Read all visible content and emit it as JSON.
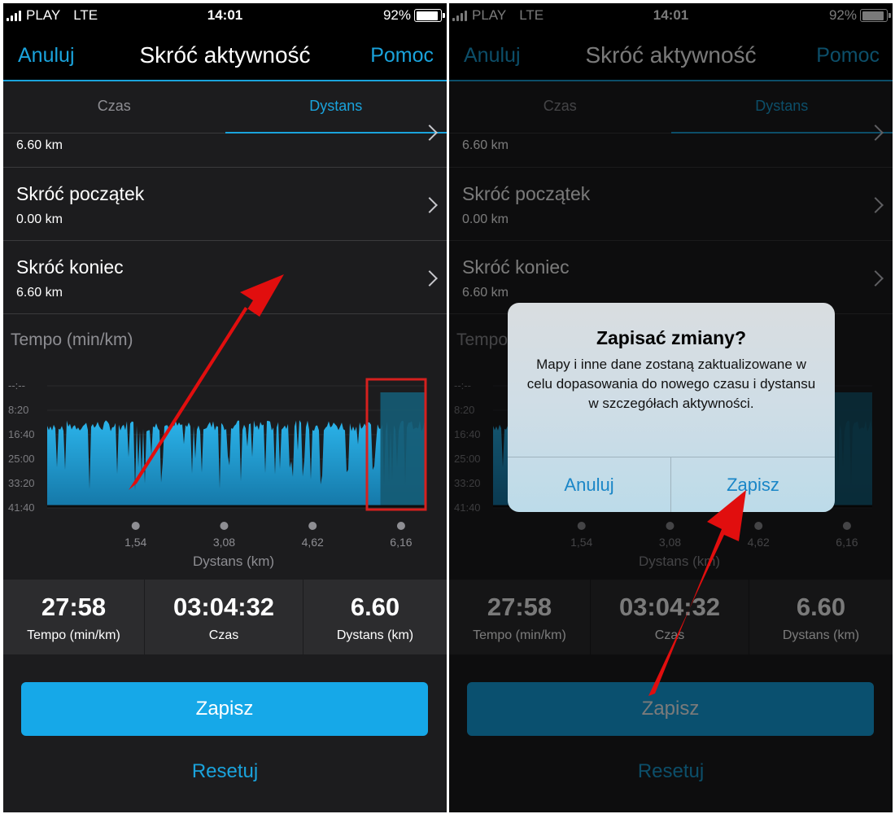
{
  "status": {
    "carrier": "PLAY",
    "network": "LTE",
    "time": "14:01",
    "battery": "92%",
    "battery_level": 0.92
  },
  "nav": {
    "cancel": "Anuluj",
    "title": "Skróć aktywność",
    "help": "Pomoc"
  },
  "tabs": [
    {
      "label": "Czas",
      "active": false
    },
    {
      "label": "Dystans",
      "active": true
    }
  ],
  "rows": {
    "total_value": "6.60 km",
    "trim_start": {
      "title": "Skróć początek",
      "value": "0.00 km"
    },
    "trim_end": {
      "title": "Skróć koniec",
      "value": "6.60 km"
    }
  },
  "chart_data": {
    "type": "area",
    "title": "Tempo (min/km)",
    "xlabel": "Dystans (km)",
    "ylabel": "",
    "x_ticks": [
      "1,54",
      "3,08",
      "4,62",
      "6,16"
    ],
    "x_tick_values": [
      1.54,
      3.08,
      4.62,
      6.16
    ],
    "y_ticks": [
      "--:--",
      "8:20",
      "16:40",
      "25:00",
      "33:20",
      "41:40"
    ],
    "xlim": [
      0,
      6.6
    ],
    "highlight_range_km": [
      5.8,
      6.6
    ],
    "grid": true
  },
  "stats": [
    {
      "value": "27:58",
      "label": "Tempo (min/km)"
    },
    {
      "value": "03:04:32",
      "label": "Czas"
    },
    {
      "value": "6.60",
      "label": "Dystans (km)"
    }
  ],
  "actions": {
    "save": "Zapisz",
    "reset": "Resetuj"
  },
  "dialog": {
    "title": "Zapisać zmiany?",
    "message": "Mapy i inne dane zostaną zaktualizowane w celu dopasowania do nowego czasu i dystansu w szczegółach aktywności.",
    "cancel": "Anuluj",
    "confirm": "Zapisz"
  },
  "colors": {
    "accent": "#1aa3dc",
    "button": "#16a8e8",
    "arrow": "#e10e0e",
    "highlight_box": "#d5201e"
  }
}
